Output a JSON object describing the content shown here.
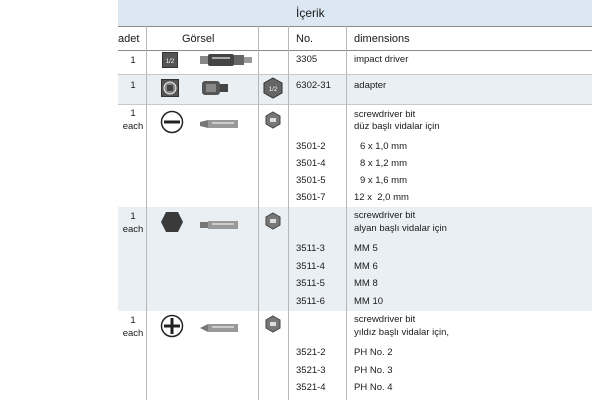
{
  "title": "İçerik",
  "headers": {
    "adet": "adet",
    "gorsel": "Görsel",
    "no": "No.",
    "dimensions": "dimensions"
  },
  "rows": {
    "impact": {
      "qty": "1",
      "no": "3305",
      "desc": "impact driver",
      "badge": "1/2"
    },
    "adapter": {
      "qty": "1",
      "no": "6302-31",
      "desc": "adapter",
      "badge": "1/2"
    },
    "slot": {
      "qty": "1",
      "each": "each",
      "desc1": "screwdriver bit",
      "desc2": "düz başlı vidalar için",
      "items": [
        {
          "no": "3501-2",
          "dim": "6 x 1,0 mm"
        },
        {
          "no": "3501-4",
          "dim": "8 x 1,2 mm"
        },
        {
          "no": "3501-5",
          "dim": "9 x 1,6 mm"
        },
        {
          "no": "3501-7",
          "dim": "12 x  2,0 mm"
        }
      ]
    },
    "hex": {
      "qty": "1",
      "each": "each",
      "desc1": "screwdriver bit",
      "desc2": "alyan başlı vidalar için",
      "items": [
        {
          "no": "3511-3",
          "dim": "MM 5"
        },
        {
          "no": "3511-4",
          "dim": "MM 6"
        },
        {
          "no": "3511-5",
          "dim": "MM 8"
        },
        {
          "no": "3511-6",
          "dim": "MM 10"
        }
      ]
    },
    "phillips": {
      "qty": "1",
      "each": "each",
      "desc1": "screwdriver bit",
      "desc2": "yıldız başlı vidalar için,",
      "items": [
        {
          "no": "3521-2",
          "dim": "PH No. 2"
        },
        {
          "no": "3521-3",
          "dim": "PH No. 3"
        },
        {
          "no": "3521-4",
          "dim": "PH No. 4"
        }
      ]
    }
  }
}
